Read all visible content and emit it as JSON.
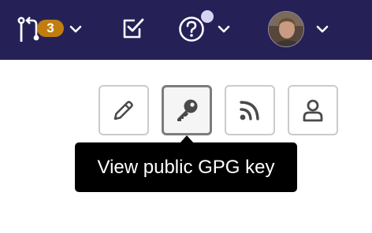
{
  "header": {
    "pull_requests": {
      "icon": "pull-request-icon",
      "count": "3"
    },
    "tasks": {
      "icon": "checkbox-icon"
    },
    "help": {
      "icon": "question-circle-icon",
      "has_notification": true
    },
    "user": {
      "icon": "avatar"
    },
    "colors": {
      "bar": "#252157",
      "badge": "#c17d10"
    }
  },
  "profile_actions": [
    {
      "icon": "pencil-icon"
    },
    {
      "icon": "key-icon"
    },
    {
      "icon": "rss-icon"
    },
    {
      "icon": "user-icon"
    }
  ],
  "tooltip": {
    "text": "View public GPG key"
  }
}
